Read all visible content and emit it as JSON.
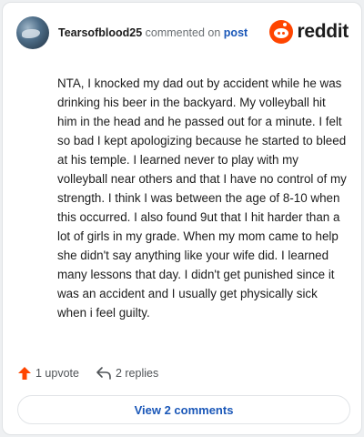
{
  "header": {
    "username": "Tearsofblood25",
    "commented_text": " commented on ",
    "post_link": "post",
    "logo_text": "reddit"
  },
  "comment": {
    "text": "NTA, I knocked my dad out by accident while he was drinking his beer in the backyard. My volleyball hit him in the head and he passed out for a minute. I felt so bad I kept apologizing because he started to bleed at his temple. I learned never to play with my volleyball near others and that I have no control of my strength. I think I was between the age of 8-10 when this occurred. I also found 9ut that I hit harder than a lot of girls in my grade. When my mom came to help she didn't say anything like your wife did. I learned many lessons that day. I didn't get punished since it was an accident and I usually get physically sick when i feel guilty."
  },
  "actions": {
    "upvote_label": "1 upvote",
    "replies_label": "2 replies"
  },
  "footer": {
    "view_comments_label": "View 2 comments"
  },
  "colors": {
    "upvote": "#ff4500",
    "link": "#1a57b8",
    "brand": "#ff4500"
  },
  "icons": {
    "upvote": "upvote-arrow-icon",
    "reply": "reply-arrow-icon",
    "logo": "reddit-snoo-icon",
    "avatar": "user-avatar"
  }
}
